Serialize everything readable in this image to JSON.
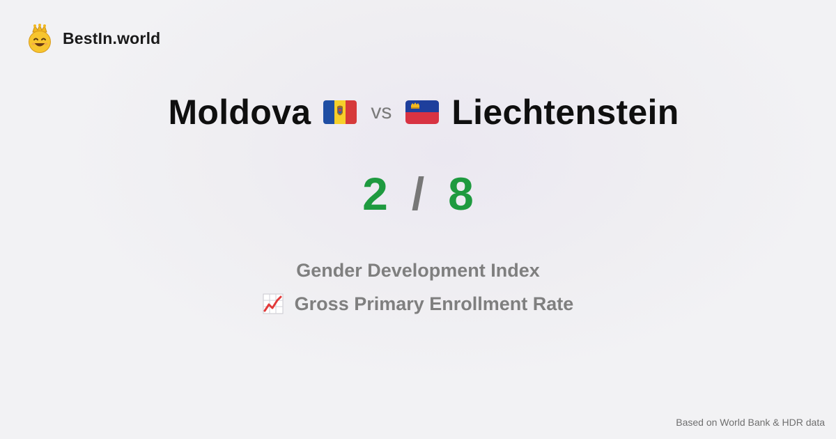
{
  "brand": {
    "name": "BestIn.world",
    "icon": "crowned-smiley-icon"
  },
  "comparison": {
    "left_country": "Moldova",
    "left_flag": "moldova-flag-icon",
    "vs_label": "vs",
    "right_country": "Liechtenstein",
    "right_flag": "liechtenstein-flag-icon"
  },
  "score": {
    "left": "2",
    "separator": "/",
    "right": "8",
    "color": "#1e9a3f"
  },
  "metrics": [
    {
      "label": "Gender Development Index",
      "icon": ""
    },
    {
      "label": "Gross Primary Enrollment Rate",
      "icon": "chart-increasing-icon"
    }
  ],
  "footer": {
    "source": "Based on World Bank & HDR data"
  }
}
